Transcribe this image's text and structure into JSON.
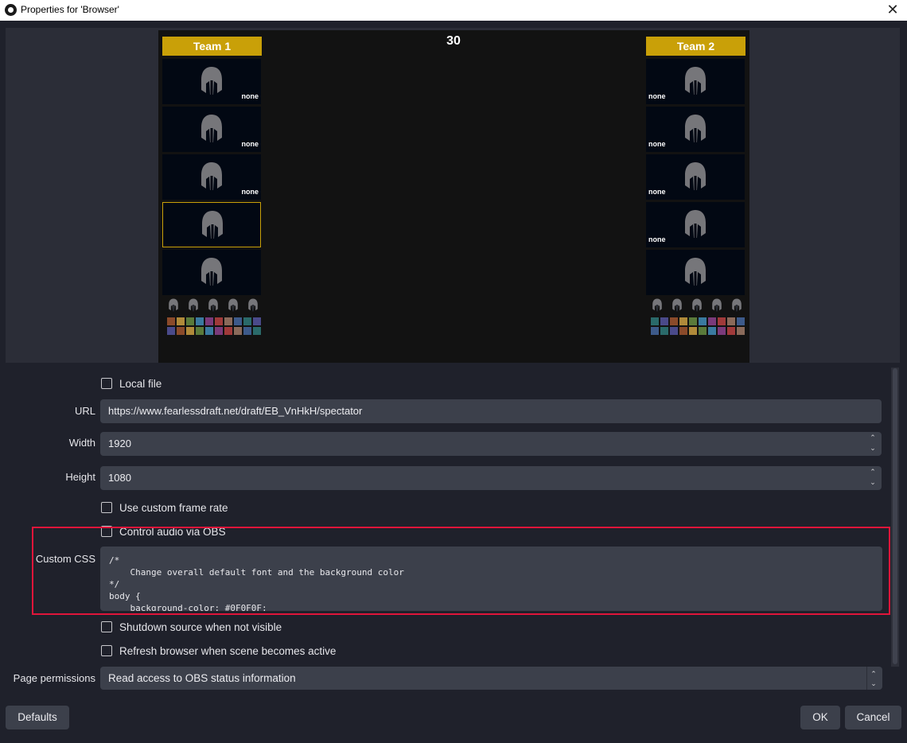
{
  "window": {
    "title": "Properties for 'Browser'",
    "close_glyph": "✕"
  },
  "preview": {
    "timer": "30",
    "team1": {
      "header": "Team 1",
      "slots": [
        {
          "name": "none"
        },
        {
          "name": "none"
        },
        {
          "name": "none"
        },
        {
          "name": ""
        },
        {
          "name": ""
        }
      ]
    },
    "team2": {
      "header": "Team 2",
      "slots": [
        {
          "name": "none"
        },
        {
          "name": "none"
        },
        {
          "name": "none"
        },
        {
          "name": "none"
        },
        {
          "name": ""
        }
      ]
    },
    "colors": {
      "header": "#c9a008",
      "slot_bg": "#020813",
      "preview_bg": "#121212"
    }
  },
  "form": {
    "local_file": {
      "label": "Local file",
      "checked": false
    },
    "url": {
      "label": "URL",
      "value": "https://www.fearlessdraft.net/draft/EB_VnHkH/spectator"
    },
    "width": {
      "label": "Width",
      "value": "1920"
    },
    "height": {
      "label": "Height",
      "value": "1080"
    },
    "custom_frame_rate": {
      "label": "Use custom frame rate",
      "checked": false
    },
    "control_audio": {
      "label": "Control audio via OBS",
      "checked": false
    },
    "custom_css": {
      "label": "Custom CSS",
      "value": "/*\n    Change overall default font and the background color\n*/\nbody {\n    background-color: #0F0F0F;"
    },
    "shutdown_source": {
      "label": "Shutdown source when not visible",
      "checked": false
    },
    "refresh_browser": {
      "label": "Refresh browser when scene becomes active",
      "checked": false
    },
    "page_permissions": {
      "label": "Page permissions",
      "value": "Read access to OBS status information"
    }
  },
  "buttons": {
    "defaults": "Defaults",
    "ok": "OK",
    "cancel": "Cancel"
  },
  "highlight_color": "#e0153a"
}
